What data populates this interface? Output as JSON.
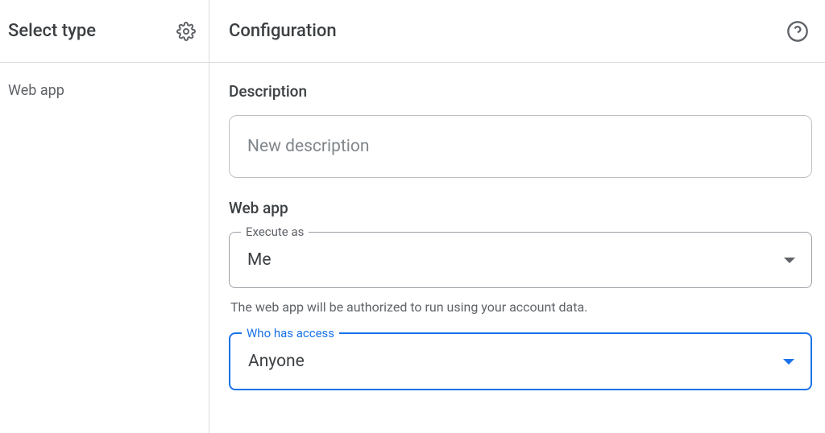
{
  "sidebar": {
    "title": "Select type",
    "items": [
      {
        "label": "Web app"
      }
    ]
  },
  "main": {
    "title": "Configuration",
    "description": {
      "label": "Description",
      "placeholder": "New description",
      "value": ""
    },
    "webapp": {
      "label": "Web app",
      "execute_as": {
        "legend": "Execute as",
        "value": "Me",
        "helper": "The web app will be authorized to run using your account data."
      },
      "who_has_access": {
        "legend": "Who has access",
        "value": "Anyone"
      }
    }
  }
}
